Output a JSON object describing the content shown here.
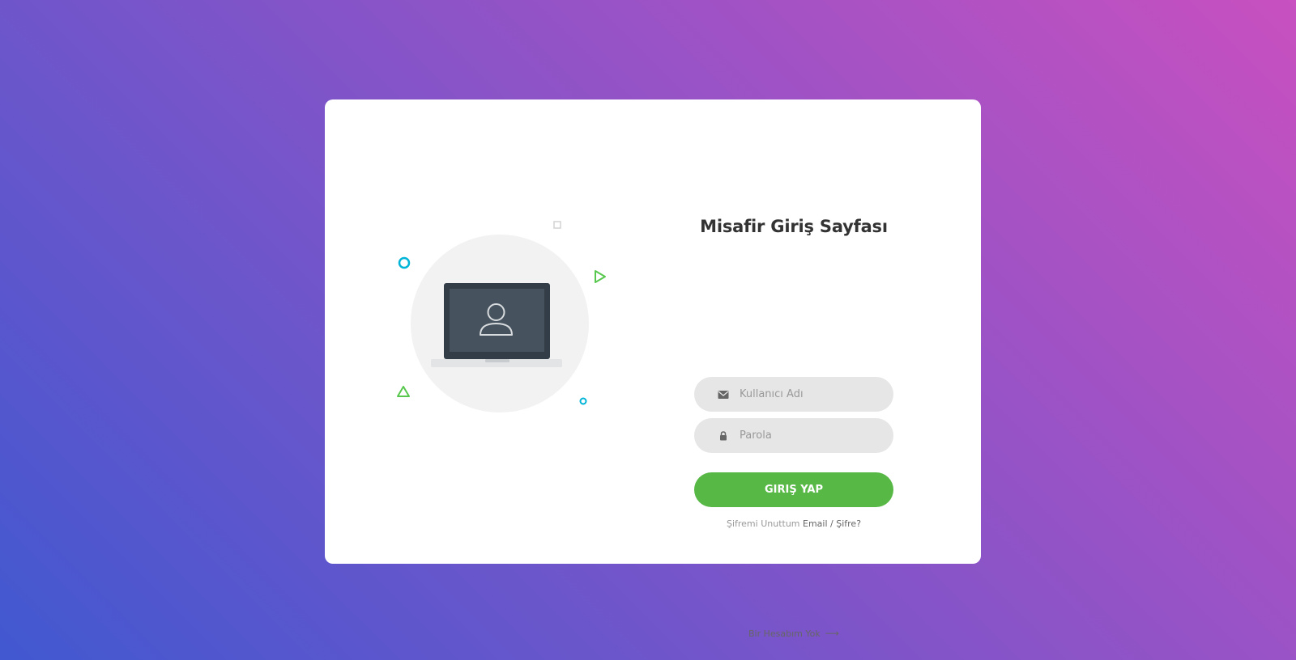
{
  "colors": {
    "gradient_start": "#4158d0",
    "gradient_end": "#c850c0",
    "card_bg": "#ffffff",
    "input_bg": "#e6e6e6",
    "button_bg": "#57b846",
    "accent_cyan": "#00b4d8",
    "accent_green": "#57b846"
  },
  "illustration": {
    "icon": "laptop-user-icon",
    "decorations": [
      "circle-icon",
      "square-icon",
      "triangle-right-icon",
      "triangle-up-icon",
      "small-circle-icon"
    ]
  },
  "form": {
    "title": "Misafir Giriş Sayfası",
    "username": {
      "placeholder": "Kullanıcı Adı",
      "value": "",
      "icon": "envelope-icon"
    },
    "password": {
      "placeholder": "Parola",
      "value": "",
      "icon": "lock-icon"
    },
    "submit_label": "GIRIŞ YAP",
    "forgot_text": "Şifremi Unuttum",
    "forgot_link": "Email / Şifre?",
    "signup_label": "Bir Hesabım Yok",
    "signup_icon": "arrow-right-icon"
  }
}
